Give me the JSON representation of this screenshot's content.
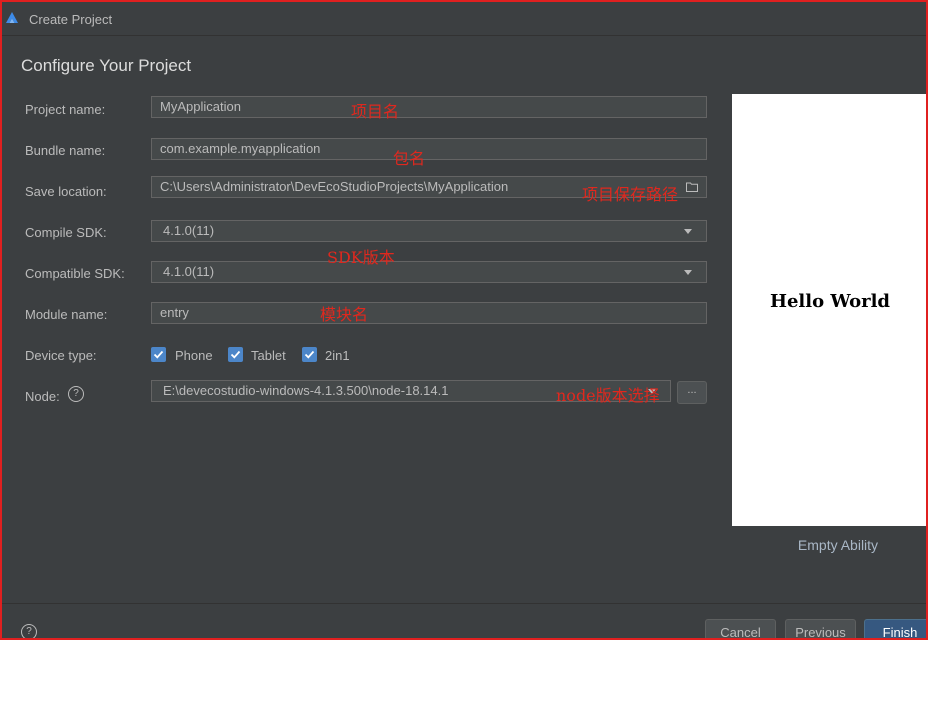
{
  "window": {
    "title": "Create Project"
  },
  "heading": "Configure Your Project",
  "form": {
    "project_name": {
      "label": "Project name:",
      "value": "MyApplication"
    },
    "bundle_name": {
      "label": "Bundle name:",
      "value": "com.example.myapplication"
    },
    "save_location": {
      "label": "Save location:",
      "value": "C:\\Users\\Administrator\\DevEcoStudioProjects\\MyApplication"
    },
    "compile_sdk": {
      "label": "Compile SDK:",
      "value": "4.1.0(11)"
    },
    "compatible_sdk": {
      "label": "Compatible SDK:",
      "value": "4.1.0(11)"
    },
    "module_name": {
      "label": "Module name:",
      "value": "entry"
    },
    "device_type": {
      "label": "Device type:",
      "options": [
        "Phone",
        "Tablet",
        "2in1"
      ]
    },
    "node": {
      "label": "Node:",
      "value": "E:\\devecostudio-windows-4.1.3.500\\node-18.14.1",
      "browse_label": "..."
    },
    "help_glyph": "?"
  },
  "annotations": {
    "project_name": "项目名",
    "bundle_name": "包名",
    "save_location": "项目保存路径",
    "sdk": "SDK版本",
    "module": "模块名",
    "node": "node版本选择"
  },
  "preview": {
    "text": "Hello World",
    "template": "Empty Ability"
  },
  "footer": {
    "help_glyph": "?",
    "cancel": "Cancel",
    "previous": "Previous",
    "finish": "Finish"
  },
  "colors": {
    "background": "#3c3f41",
    "accent": "#4c86c9",
    "annotation": "#e0281e",
    "primary_button": "#365880"
  }
}
